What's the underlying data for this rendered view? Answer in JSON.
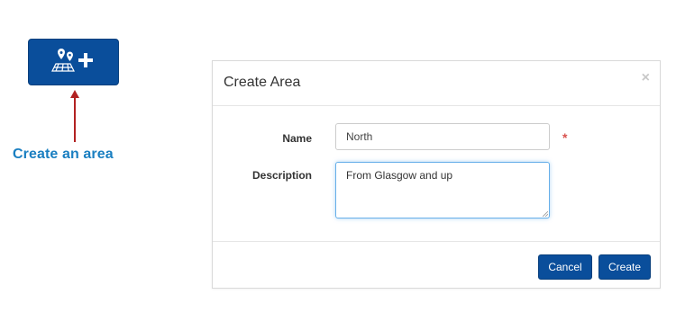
{
  "annotation": {
    "label": "Create an area",
    "button_icon": "create-area-icon",
    "arrow_color": "#b22222"
  },
  "modal": {
    "title": "Create Area",
    "close_glyph": "×",
    "fields": {
      "name_label": "Name",
      "name_value": "North",
      "required_mark": "*",
      "description_label": "Description",
      "description_value": "From Glasgow and up"
    },
    "buttons": {
      "cancel_label": "Cancel",
      "create_label": "Create"
    }
  },
  "colors": {
    "primary": "#0a4e9b",
    "annotation_text": "#1a7fc1",
    "required": "#d9534f",
    "focus": "#66afe9"
  }
}
